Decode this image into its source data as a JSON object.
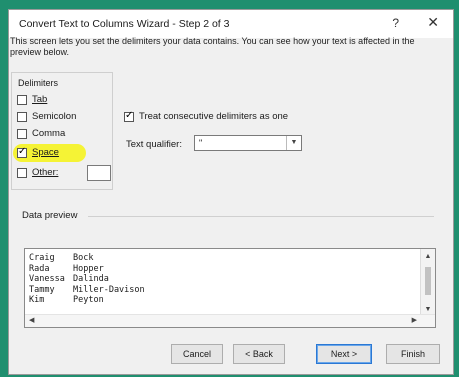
{
  "window": {
    "title": "Convert Text to Columns Wizard - Step 2 of 3",
    "help": "?",
    "close": "✕"
  },
  "description": "This screen lets you set the delimiters your data contains. You can see how your text is affected in the preview below.",
  "delimiters": {
    "group_label": "Delimiters",
    "tab": {
      "label": "Tab",
      "checked": false
    },
    "semicolon": {
      "label": "Semicolon",
      "checked": false
    },
    "comma": {
      "label": "Comma",
      "checked": false
    },
    "space": {
      "label": "Space",
      "checked": true
    },
    "other": {
      "label": "Other:",
      "checked": false,
      "value": ""
    }
  },
  "consecutive": {
    "label": "Treat consecutive delimiters as one",
    "checked": true
  },
  "qualifier": {
    "label": "Text qualifier:",
    "value": "\""
  },
  "preview": {
    "label": "Data preview",
    "rows": [
      [
        "Craig",
        "Bock"
      ],
      [
        "Rada",
        "Hopper"
      ],
      [
        "Vanessa",
        "Dalinda"
      ],
      [
        "Tammy",
        "Miller-Davison"
      ],
      [
        "Kim",
        "Peyton"
      ]
    ]
  },
  "buttons": {
    "cancel": "Cancel",
    "back": "< Back",
    "next": "Next >",
    "finish": "Finish"
  }
}
